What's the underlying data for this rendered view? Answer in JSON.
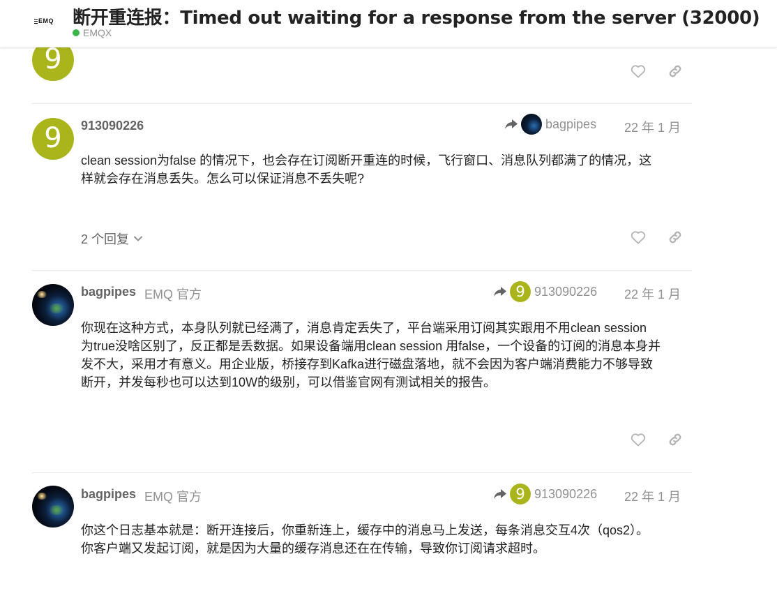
{
  "header": {
    "logo_text": "EMQ",
    "title": "断开重连报：Timed out waiting for a response from the server (32000)",
    "category": "EMQX",
    "category_color": "#3ab54a"
  },
  "colors": {
    "avatar_9": "#a9b51b",
    "muted_text": "#919191",
    "username_text": "#646464",
    "divider": "#e9e9e9"
  },
  "icons": [
    "heart-icon",
    "link-icon",
    "reply-arrow-icon",
    "chevron-down-icon"
  ],
  "posts": [
    {
      "avatar_letter": "9"
    },
    {
      "avatar_letter": "9",
      "username": "913090226",
      "reply_to_user": "bagpipes",
      "date": "22 年 1 月",
      "body": [
        "clean session为false 的情况下，也会存在订阅断开重连的时候，飞行窗口、消息队列都满了的情况，这",
        "样就会存在消息丢失。怎么可以保证消息不丢失呢?"
      ],
      "replies_label": "2 个回复"
    },
    {
      "username": "bagpipes",
      "user_title": "EMQ 官方",
      "reply_to_user": "913090226",
      "reply_to_avatar_letter": "9",
      "date": "22 年 1 月",
      "body": [
        "你现在这种方式，本身队列就已经满了，消息肯定丢失了，平台端采用订阅其实跟用不用clean session",
        "为true没啥区别了，反正都是丢数据。如果设备端用clean session 用false，一个设备的订阅的消息本身并",
        "发不大，采用才有意义。用企业版，桥接存到Kafka进行磁盘落地，就不会因为客户端消费能力不够导致",
        "断开，并发每秒也可以达到10W的级别，可以借鉴官网有测试相关的报告。"
      ]
    },
    {
      "username": "bagpipes",
      "user_title": "EMQ 官方",
      "reply_to_user": "913090226",
      "reply_to_avatar_letter": "9",
      "date": "22 年 1 月",
      "body": [
        "你这个日志基本就是：断开连接后，你重新连上，缓存中的消息马上发送，每条消息交互4次（qos2）。",
        "你客户端又发起订阅，就是因为大量的缓存消息还在在传输，导致你订阅请求超时。"
      ]
    }
  ]
}
